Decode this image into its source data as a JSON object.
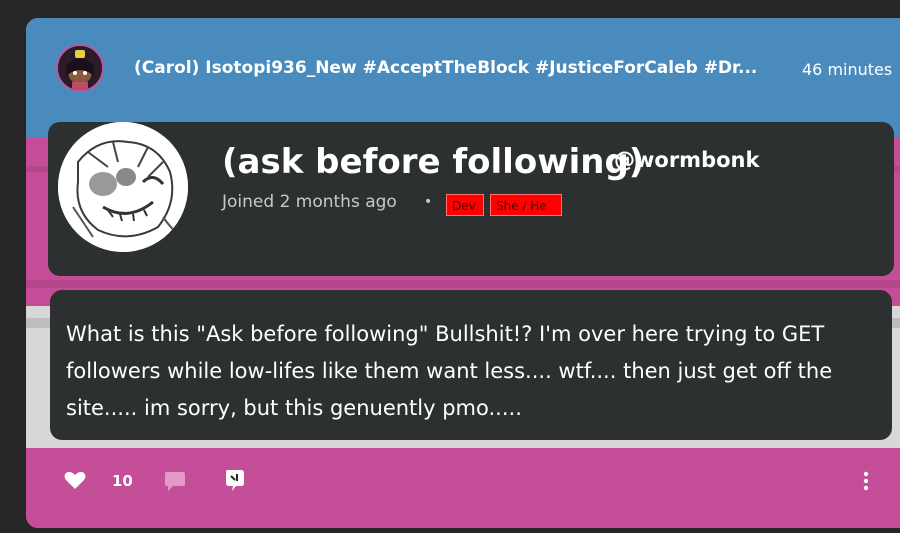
{
  "post": {
    "username": "(Carol) Isotopi936_New #AcceptTheBlock #JusticeForCaleb #Dr...",
    "timestamp": "46 minutes",
    "profile": {
      "display_name": "(ask before following)",
      "handle": "@wormbonk",
      "joined": "Joined 2 months ago",
      "separator": "•",
      "badges": [
        "Dev",
        "She / He"
      ]
    },
    "message": "What is this \"Ask before following\" Bullshit!? I'm over here trying to GET followers while low-lifes like them want less.... wtf.... then just get off the site..... im sorry, but this genuently pmo.....",
    "actions": {
      "like_count": "10",
      "like_icon": "heart-icon",
      "comment_icon": "comment-bubble-icon",
      "reshare_icon": "reshare-icon",
      "more_icon": "more-vertical-icon"
    }
  },
  "colors": {
    "stripe_blue": "#4a8bbd",
    "stripe_pink": "#c54d98",
    "stripe_white": "#d8d8d8",
    "card_bg": "#2c3031",
    "badge_red": "#ff0000"
  }
}
